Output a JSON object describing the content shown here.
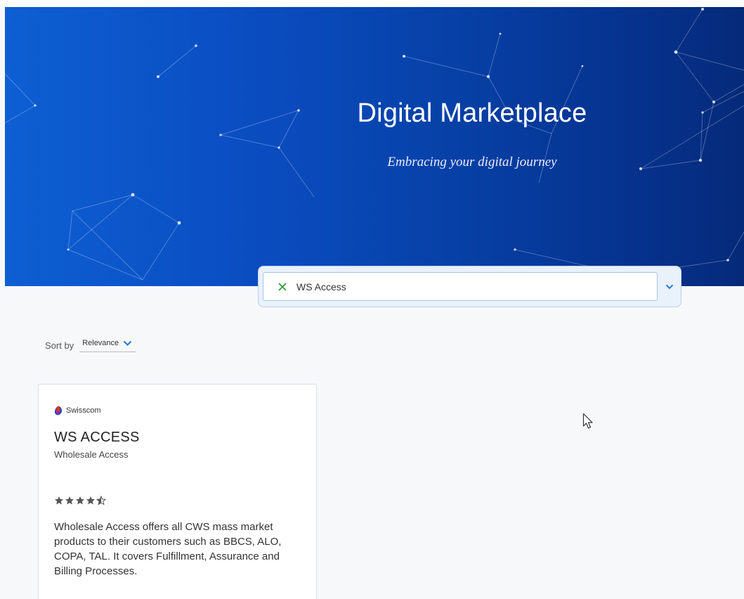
{
  "hero": {
    "title": "Digital Marketplace",
    "subtitle": "Embracing your digital journey",
    "gradient_colors": [
      "#0d5fd3",
      "#052a79"
    ]
  },
  "search": {
    "value": "WS Access",
    "clear_icon": "close-icon",
    "dropdown_icon": "chevron-down-icon",
    "accent_color": "#2b7bd6"
  },
  "sort": {
    "label": "Sort by",
    "selected": "Relevance",
    "icon": "chevron-down-icon"
  },
  "results": [
    {
      "vendor": "Swisscom",
      "title": "WS ACCESS",
      "subtitle": "Wholesale Access",
      "rating": 4.5,
      "rating_max": 5,
      "description": "Wholesale Access offers all CWS mass market products to their customers such as BBCS, ALO, COPA, TAL. It covers Fulfillment, Assurance and Billing Processes."
    }
  ]
}
